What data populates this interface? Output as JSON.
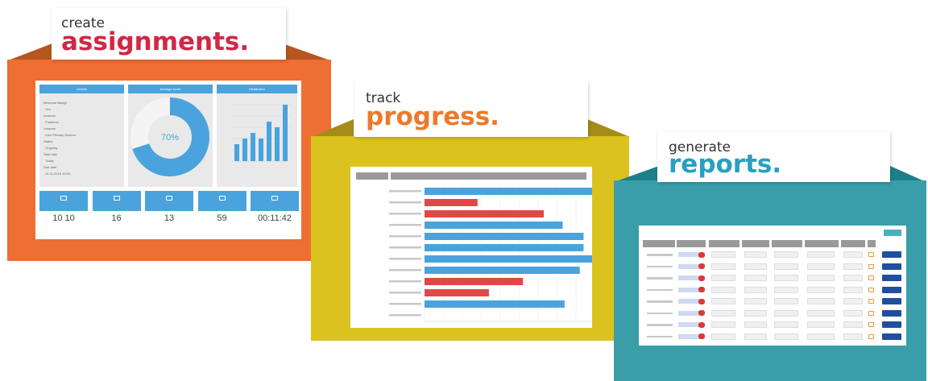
{
  "colors": {
    "orange": "#ee6e33",
    "orange_dark": "#b55520",
    "yellow": "#dcc21e",
    "yellow_dark": "#a68a1a",
    "teal": "#3a9ea8",
    "teal_dark": "#1e7f8a",
    "crimson": "#d12845",
    "amber": "#ec7a2c",
    "cyan": "#2a9fc0",
    "blue": "#4aa3dd",
    "red": "#e04747"
  },
  "panels": {
    "assignments": {
      "small_text": "create",
      "big_text": "assignments.",
      "donut_value": "70%",
      "stats": [
        {
          "value": "10",
          "extra": "10"
        },
        {
          "value": "16"
        },
        {
          "value": "13"
        },
        {
          "value": "59"
        },
        {
          "value": "00:11:42"
        }
      ],
      "bar_values": [
        3,
        4,
        5,
        4,
        7,
        6,
        10
      ]
    },
    "progress": {
      "small_text": "track",
      "big_text": "progress.",
      "bars": [
        {
          "value": 98,
          "color": "blue"
        },
        {
          "value": 28,
          "color": "red"
        },
        {
          "value": 63,
          "color": "red"
        },
        {
          "value": 73,
          "color": "blue"
        },
        {
          "value": 84,
          "color": "blue"
        },
        {
          "value": 84,
          "color": "blue"
        },
        {
          "value": 99,
          "color": "blue"
        },
        {
          "value": 82,
          "color": "blue"
        },
        {
          "value": 52,
          "color": "red"
        },
        {
          "value": 34,
          "color": "red"
        },
        {
          "value": 74,
          "color": "blue"
        },
        {
          "value": 0,
          "color": "blue"
        }
      ]
    },
    "reports": {
      "small_text": "generate",
      "big_text": "reports.",
      "row_count": 8
    }
  }
}
